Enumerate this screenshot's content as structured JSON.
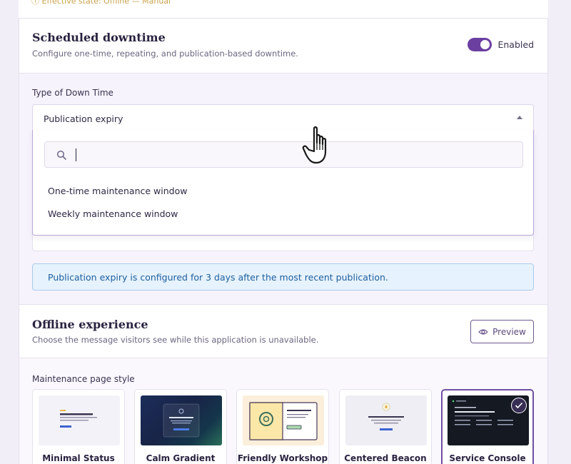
{
  "top_strip": {
    "text": "Effective state: Offline — Manual"
  },
  "scheduled": {
    "title": "Scheduled downtime",
    "subtitle": "Configure one-time, repeating, and publication-based downtime.",
    "toggle_label": "Enabled",
    "type_label": "Type of Down Time",
    "selected_type": "Publication expiry",
    "search_placeholder": "",
    "options": [
      "One-time maintenance window",
      "Weekly maintenance window"
    ],
    "info_text": "Publication expiry is configured for 3 days after the most recent publication."
  },
  "offline": {
    "title": "Offline experience",
    "subtitle": "Choose the message visitors see while this application is unavailable.",
    "preview_label": "Preview",
    "style_label": "Maintenance page style",
    "cards": [
      {
        "name": "Minimal Status"
      },
      {
        "name": "Calm Gradient"
      },
      {
        "name": "Friendly Workshop"
      },
      {
        "name": "Centered Beacon"
      },
      {
        "name": "Service Console"
      }
    ]
  },
  "colors": {
    "accent": "#6a3fa0",
    "info_bg": "#e6f2fd",
    "info_text": "#1d5f9e"
  }
}
